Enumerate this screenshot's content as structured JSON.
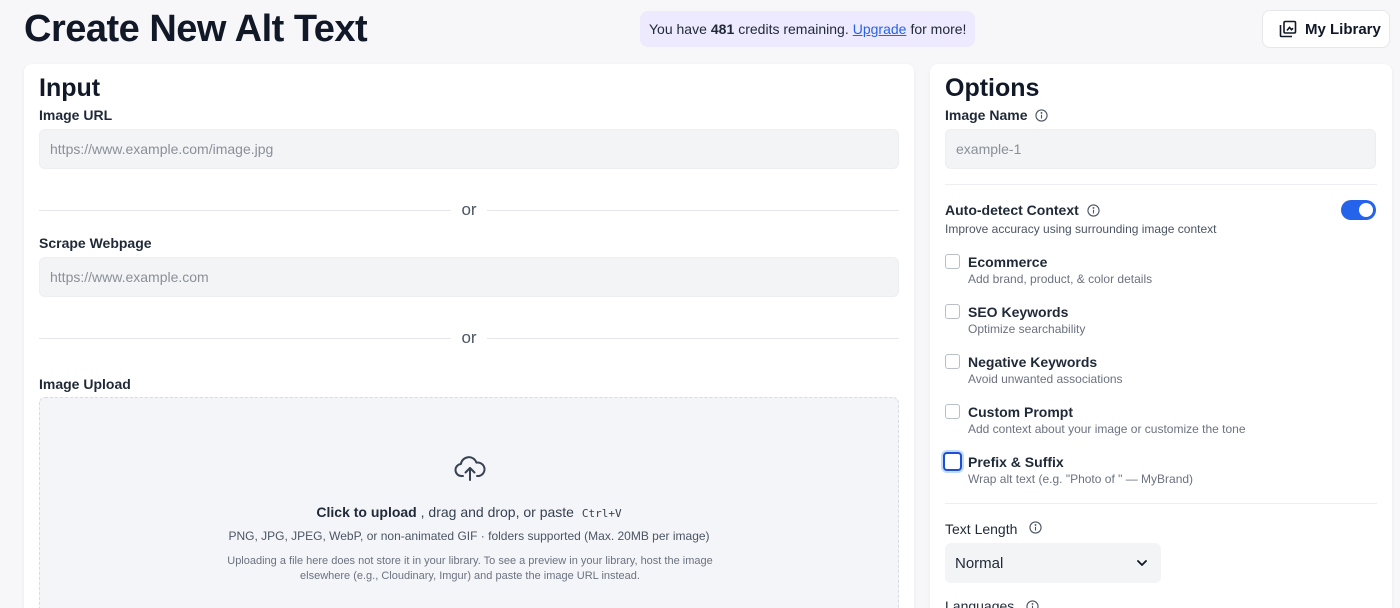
{
  "page": {
    "title": "Create New Alt Text"
  },
  "credits": {
    "prefix": "You have",
    "count": "481",
    "middle": "credits remaining.",
    "link": "Upgrade",
    "suffix": "for more!"
  },
  "header": {
    "library_label": "My Library"
  },
  "input": {
    "heading": "Input",
    "image_url_label": "Image URL",
    "image_url_placeholder": "https://www.example.com/image.jpg",
    "or_1": "or",
    "scrape_label": "Scrape Webpage",
    "scrape_placeholder": "https://www.example.com",
    "or_2": "or",
    "upload_label": "Image Upload",
    "upload": {
      "click_text": "Click to upload",
      "rest_text": ", drag and drop, or paste",
      "shortcut": "Ctrl+V",
      "formats": "PNG, JPG, JPEG, WebP, or non-animated GIF · folders supported (Max. 20MB per image)",
      "note": "Uploading a file here does not store it in your library. To see a preview in your library, host the image elsewhere (e.g., Cloudinary, Imgur) and paste the image URL instead."
    }
  },
  "options": {
    "heading": "Options",
    "image_name_label": "Image Name",
    "image_name_placeholder": "example-1",
    "auto_detect": {
      "label": "Auto-detect Context",
      "description": "Improve accuracy using surrounding image context",
      "enabled": true
    },
    "checkboxes": [
      {
        "title": "Ecommerce",
        "desc": "Add brand, product, & color details",
        "checked": false
      },
      {
        "title": "SEO Keywords",
        "desc": "Optimize searchability",
        "checked": false
      },
      {
        "title": "Negative Keywords",
        "desc": "Avoid unwanted associations",
        "checked": false
      },
      {
        "title": "Custom Prompt",
        "desc": "Add context about your image or customize the tone",
        "checked": false
      },
      {
        "title": "Prefix & Suffix",
        "desc": "Wrap alt text (e.g. \"Photo of \" — MyBrand)",
        "checked": false
      }
    ],
    "text_length_label": "Text Length",
    "text_length_value": "Normal",
    "languages_label": "Languages"
  },
  "icons": {
    "library": "library-icon",
    "upload": "cloud-upload-icon",
    "info": "info-icon",
    "chevron": "chevron-down-icon"
  },
  "colors": {
    "accent": "#2563eb",
    "credits_bg": "#ede9fe"
  }
}
